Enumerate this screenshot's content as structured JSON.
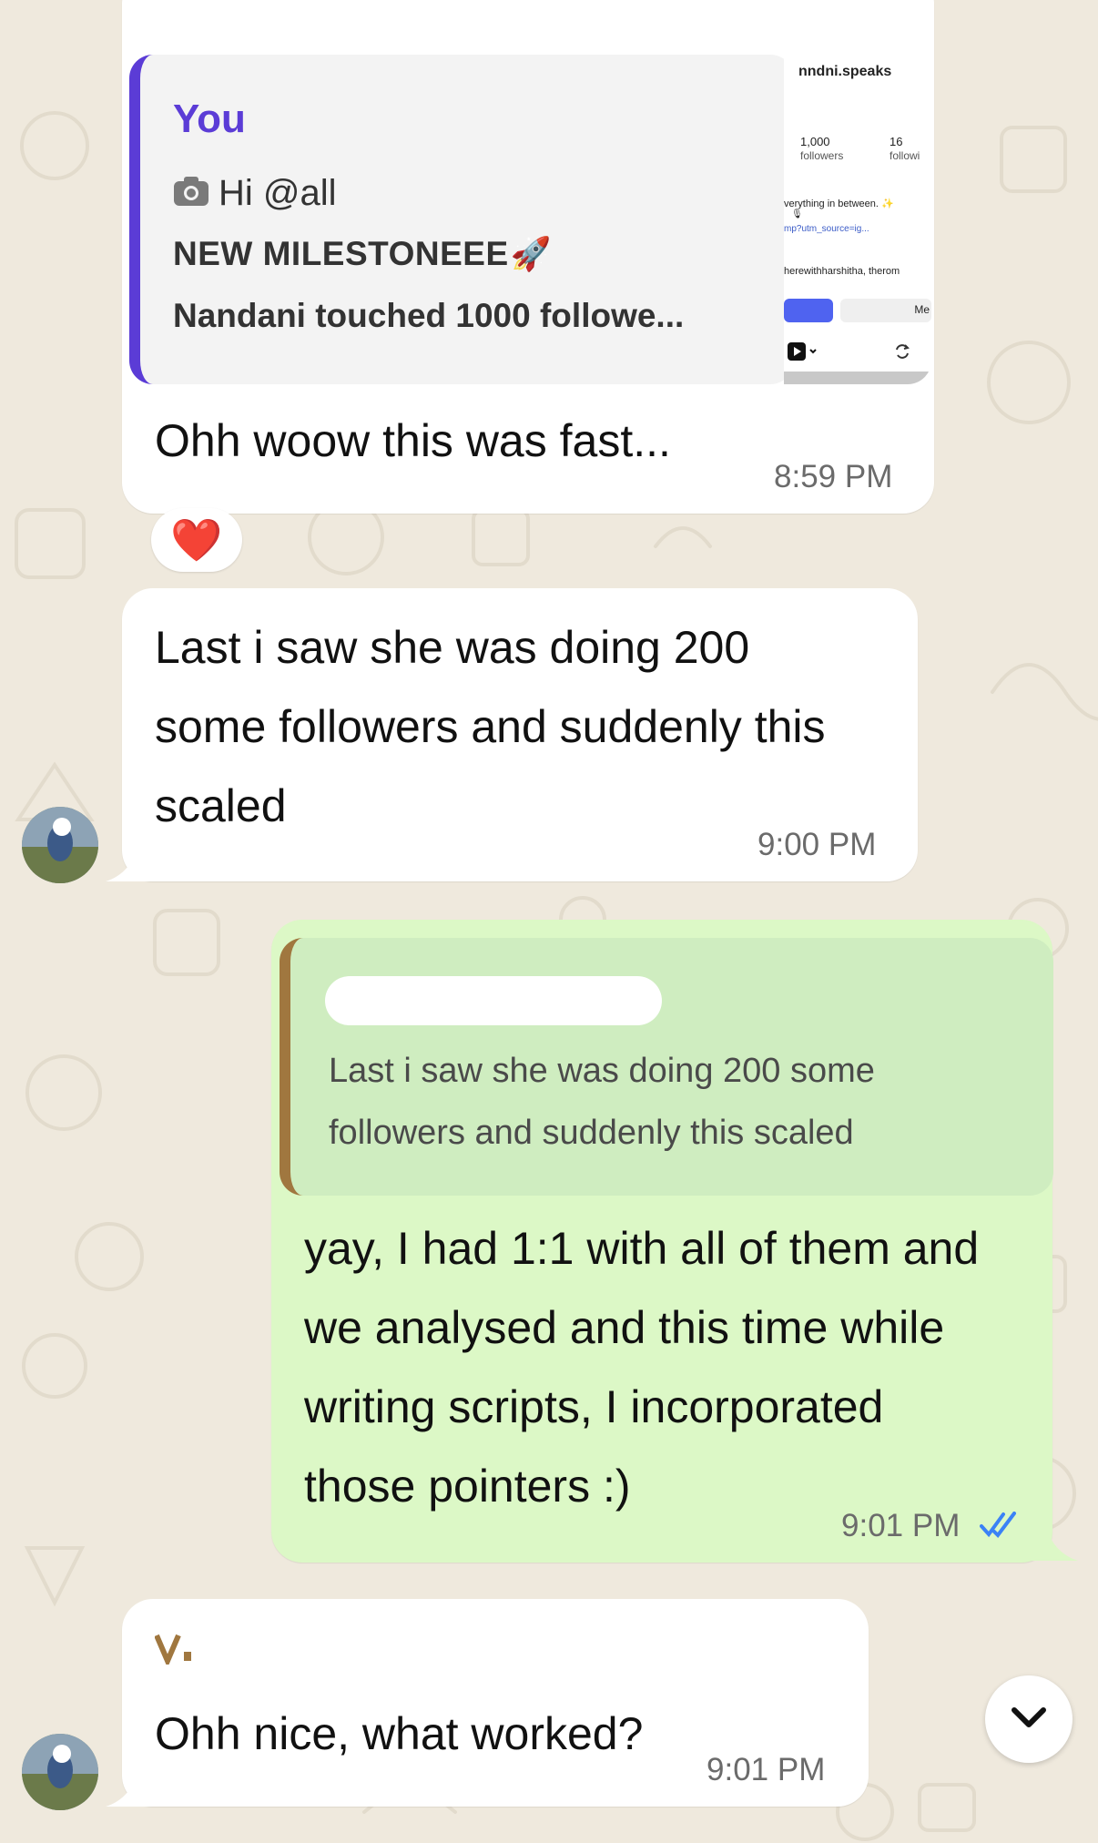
{
  "messages": [
    {
      "direction": "incoming",
      "reply": {
        "sender": "You",
        "line1": "Hi @all",
        "line2": "NEW MILESTONEEE",
        "line2_emoji": "🚀",
        "line3": "Nandani touched 1000 followe...",
        "thumbnail": {
          "handle": "nndni.speaks",
          "followers_count": "1,000",
          "followers_label": "followers",
          "following_count": "16",
          "following_label": "followi",
          "bio1": "verything in between. ✨",
          "bio2": "🎙",
          "link": "mp?utm_source=ig...",
          "mention": "herewithharshitha, therom",
          "button_label": "Me"
        }
      },
      "text": "Ohh woow this was fast...",
      "time": "8:59 PM",
      "reaction": "❤️"
    },
    {
      "direction": "incoming",
      "text_lines": [
        "Last i saw she was doing 200",
        "some followers and suddenly this",
        "scaled"
      ],
      "time": "9:00 PM"
    },
    {
      "direction": "outgoing",
      "reply": {
        "text_lines": [
          "Last i saw she was doing 200 some",
          "followers and suddenly this scaled"
        ]
      },
      "text_lines": [
        "yay, I had 1:1 with all of them and",
        "we analysed and this time while",
        "writing scripts, I incorporated",
        "those pointers :)"
      ],
      "time": "9:01 PM",
      "status": "read"
    },
    {
      "direction": "incoming",
      "text": "Ohh nice, what worked?",
      "time": "9:01 PM"
    }
  ],
  "icons": {
    "camera": "camera-icon",
    "read_receipt": "double-check-icon",
    "scroll_down": "chevron-down-icon"
  },
  "colors": {
    "background": "#efe9dd",
    "incoming_bubble": "#ffffff",
    "outgoing_bubble": "#dcf8c6",
    "reply_you_accent": "#5b3cd6",
    "reply_other_accent": "#a0773f",
    "read_tick": "#3b82f6"
  }
}
